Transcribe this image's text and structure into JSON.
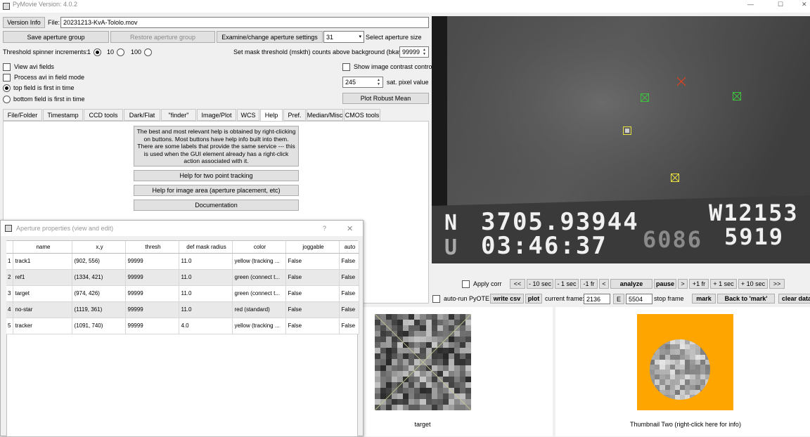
{
  "titlebar": {
    "title": "PyMovie  Version: 4.0.2",
    "minimize": "—",
    "maximize": "☐",
    "close": "✕"
  },
  "top": {
    "version_info": "Version Info",
    "file_label": "File:",
    "file_value": "20231213-KvA-Tololo.mov",
    "save_aperture_group": "Save aperture group",
    "restore_aperture_group": "Restore aperture group",
    "examine_aperture_settings": "Examine/change aperture settings",
    "aperture_size_value": "31",
    "select_aperture_size": "Select aperture size",
    "threshold_label": "Threshold spinner increments:",
    "threshold_options": [
      "1",
      "10",
      "100"
    ],
    "threshold_selected": "1",
    "mask_threshold_label": "Set mask threshold (mskth) counts above background (bkavg)",
    "mask_threshold_value": "99999",
    "view_avi_fields": "View avi fields",
    "process_avi_in_field_mode": "Process avi in field mode",
    "top_field_first": "top field is first in time",
    "bottom_field_first": "bottom field is first in time",
    "show_image_contrast": "Show image contrast control",
    "sat_pixel_value": "245",
    "sat_pixel_label": "sat. pixel value",
    "plot_robust_mean": "Plot Robust Mean"
  },
  "tabs": [
    {
      "label": "File/Folder"
    },
    {
      "label": "Timestamp"
    },
    {
      "label": "CCD tools"
    },
    {
      "label": "Dark/Flat"
    },
    {
      "label": "\"finder\""
    },
    {
      "label": "Image/Plot"
    },
    {
      "label": "WCS"
    },
    {
      "label": "Help"
    },
    {
      "label": "Pref."
    },
    {
      "label": "Median/Misc"
    },
    {
      "label": "CMOS tools"
    }
  ],
  "active_tab": "Help",
  "help": {
    "description": "The best and most relevant help is obtained by right-clicking on buttons. Most buttons have help info built into them. There are some labels that provide the same service --- this is used when the GUI element already has a right-click action associated with it.",
    "two_point_tracking": "Help for two point tracking",
    "image_area": "Help for image area (aperture placement, etc)",
    "documentation": "Documentation"
  },
  "dialog": {
    "title": "Aperture properties (view and edit)",
    "help_btn": "?",
    "close_btn": "✕",
    "columns": [
      "name",
      "x,y",
      "thresh",
      "def mask radius",
      "color",
      "joggable",
      "auto"
    ],
    "rows": [
      {
        "num": "1",
        "name": "track1",
        "xy": "(902, 556)",
        "thresh": "99999",
        "radius": "11.0",
        "color": "yellow (tracking ...",
        "joggable": "False",
        "auto": "False"
      },
      {
        "num": "2",
        "name": "ref1",
        "xy": "(1334, 421)",
        "thresh": "99999",
        "radius": "11.0",
        "color": "green (connect t...",
        "joggable": "False",
        "auto": "False"
      },
      {
        "num": "3",
        "name": "target",
        "xy": "(974, 426)",
        "thresh": "99999",
        "radius": "11.0",
        "color": "green (connect t...",
        "joggable": "False",
        "auto": "False"
      },
      {
        "num": "4",
        "name": "no-star",
        "xy": "(1119, 361)",
        "thresh": "99999",
        "radius": "11.0",
        "color": "red (standard)",
        "joggable": "False",
        "auto": "False"
      },
      {
        "num": "5",
        "name": "tracker",
        "xy": "(1091, 740)",
        "thresh": "99999",
        "radius": "4.0",
        "color": "yellow (tracking ...",
        "joggable": "False",
        "auto": "False"
      }
    ]
  },
  "image": {
    "overlay_line1_left": "N",
    "overlay_line1_mid": "3705.93944",
    "overlay_line1_right": "W12153",
    "overlay_line2_left": "U",
    "overlay_line2_mid": "03:46:37",
    "overlay_line2_dim": "6086",
    "overlay_line2_right": "5919"
  },
  "controls": {
    "apply_corr": "Apply corr",
    "back_back": "<<",
    "minus10": "- 10 sec",
    "minus1": "- 1 sec",
    "minus1fr": "-1 fr",
    "lt": "<",
    "analyze": "analyze",
    "pause": "pause",
    "gt": ">",
    "plus1fr": "+1 fr",
    "plus1": "+ 1 sec",
    "plus10": "+ 10 sec",
    "fwd_fwd": ">>",
    "auto_run_pyote": "auto-run PyOTE",
    "write_csv": "write csv",
    "plot": "plot",
    "current_frame_label": "current frame:",
    "current_frame_value": "2136",
    "e_label": "E",
    "stop_frame_value": "5504",
    "stop_frame_label": "stop frame",
    "mark": "mark",
    "back_to_mark": "Back to 'mark'",
    "clear_data": "clear data"
  },
  "thumbnails": {
    "one_label": "target",
    "two_label": "Thumbnail Two (right-click here for info)",
    "two_background": "#ffa500"
  },
  "colors": {
    "aperture_green": "#3ec23e",
    "aperture_red": "#e04020",
    "aperture_yellow": "#e8e040"
  }
}
